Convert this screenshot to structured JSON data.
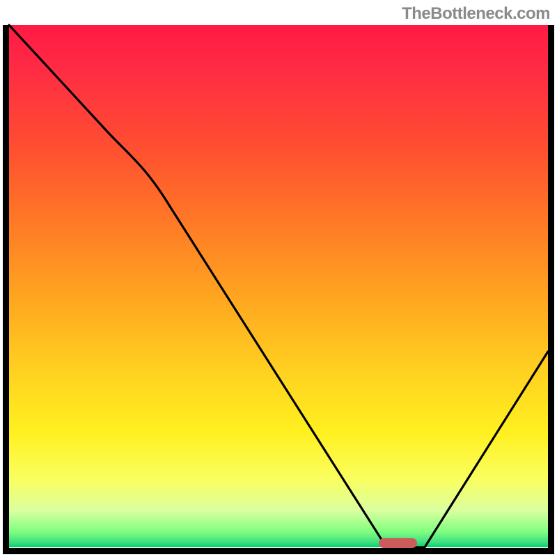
{
  "watermark": "TheBottleneck.com",
  "chart_data": {
    "type": "line",
    "title": "",
    "xlabel": "",
    "ylabel": "",
    "xlim": [
      0,
      100
    ],
    "ylim": [
      0,
      100
    ],
    "x": [
      0,
      18,
      30,
      71,
      78,
      100
    ],
    "values": [
      100,
      80,
      71,
      0,
      0,
      37
    ],
    "marker_x": 73.5,
    "marker_y": 0,
    "gradient_colors": {
      "top": "#ff1a44",
      "mid_high": "#ff7a26",
      "mid": "#ffd020",
      "mid_low": "#fff020",
      "low": "#80ff80",
      "bottom": "#00d070"
    },
    "curve_color": "#000000",
    "marker_color": "#cc5c5c"
  }
}
